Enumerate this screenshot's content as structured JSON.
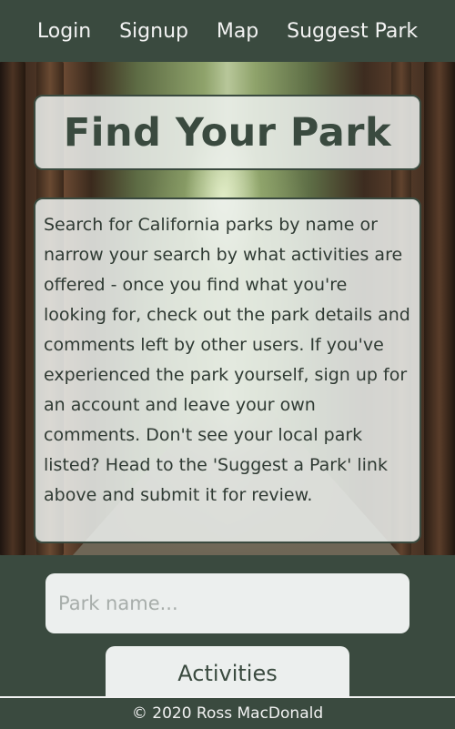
{
  "nav": {
    "items": [
      {
        "label": "Login"
      },
      {
        "label": "Signup"
      },
      {
        "label": "Map"
      },
      {
        "label": "Suggest Park"
      }
    ]
  },
  "hero": {
    "title": "Find Your Park",
    "description": "Search for California parks by name or narrow your search by what activities are offered - once you find what you're looking for, check out the park details and comments left by other users. If you've experienced the park yourself, sign up for an account and leave your own comments. Don't see your local park listed? Head to the 'Suggest a Park' link above and submit it for review."
  },
  "search": {
    "placeholder": "Park name...",
    "value": ""
  },
  "activities": {
    "label": "Activities"
  },
  "footer": {
    "text": "© 2020 Ross MacDonald"
  },
  "colors": {
    "primary": "#3a4a3f",
    "panel": "#ecefee",
    "nav_text": "#f2f2f2"
  }
}
